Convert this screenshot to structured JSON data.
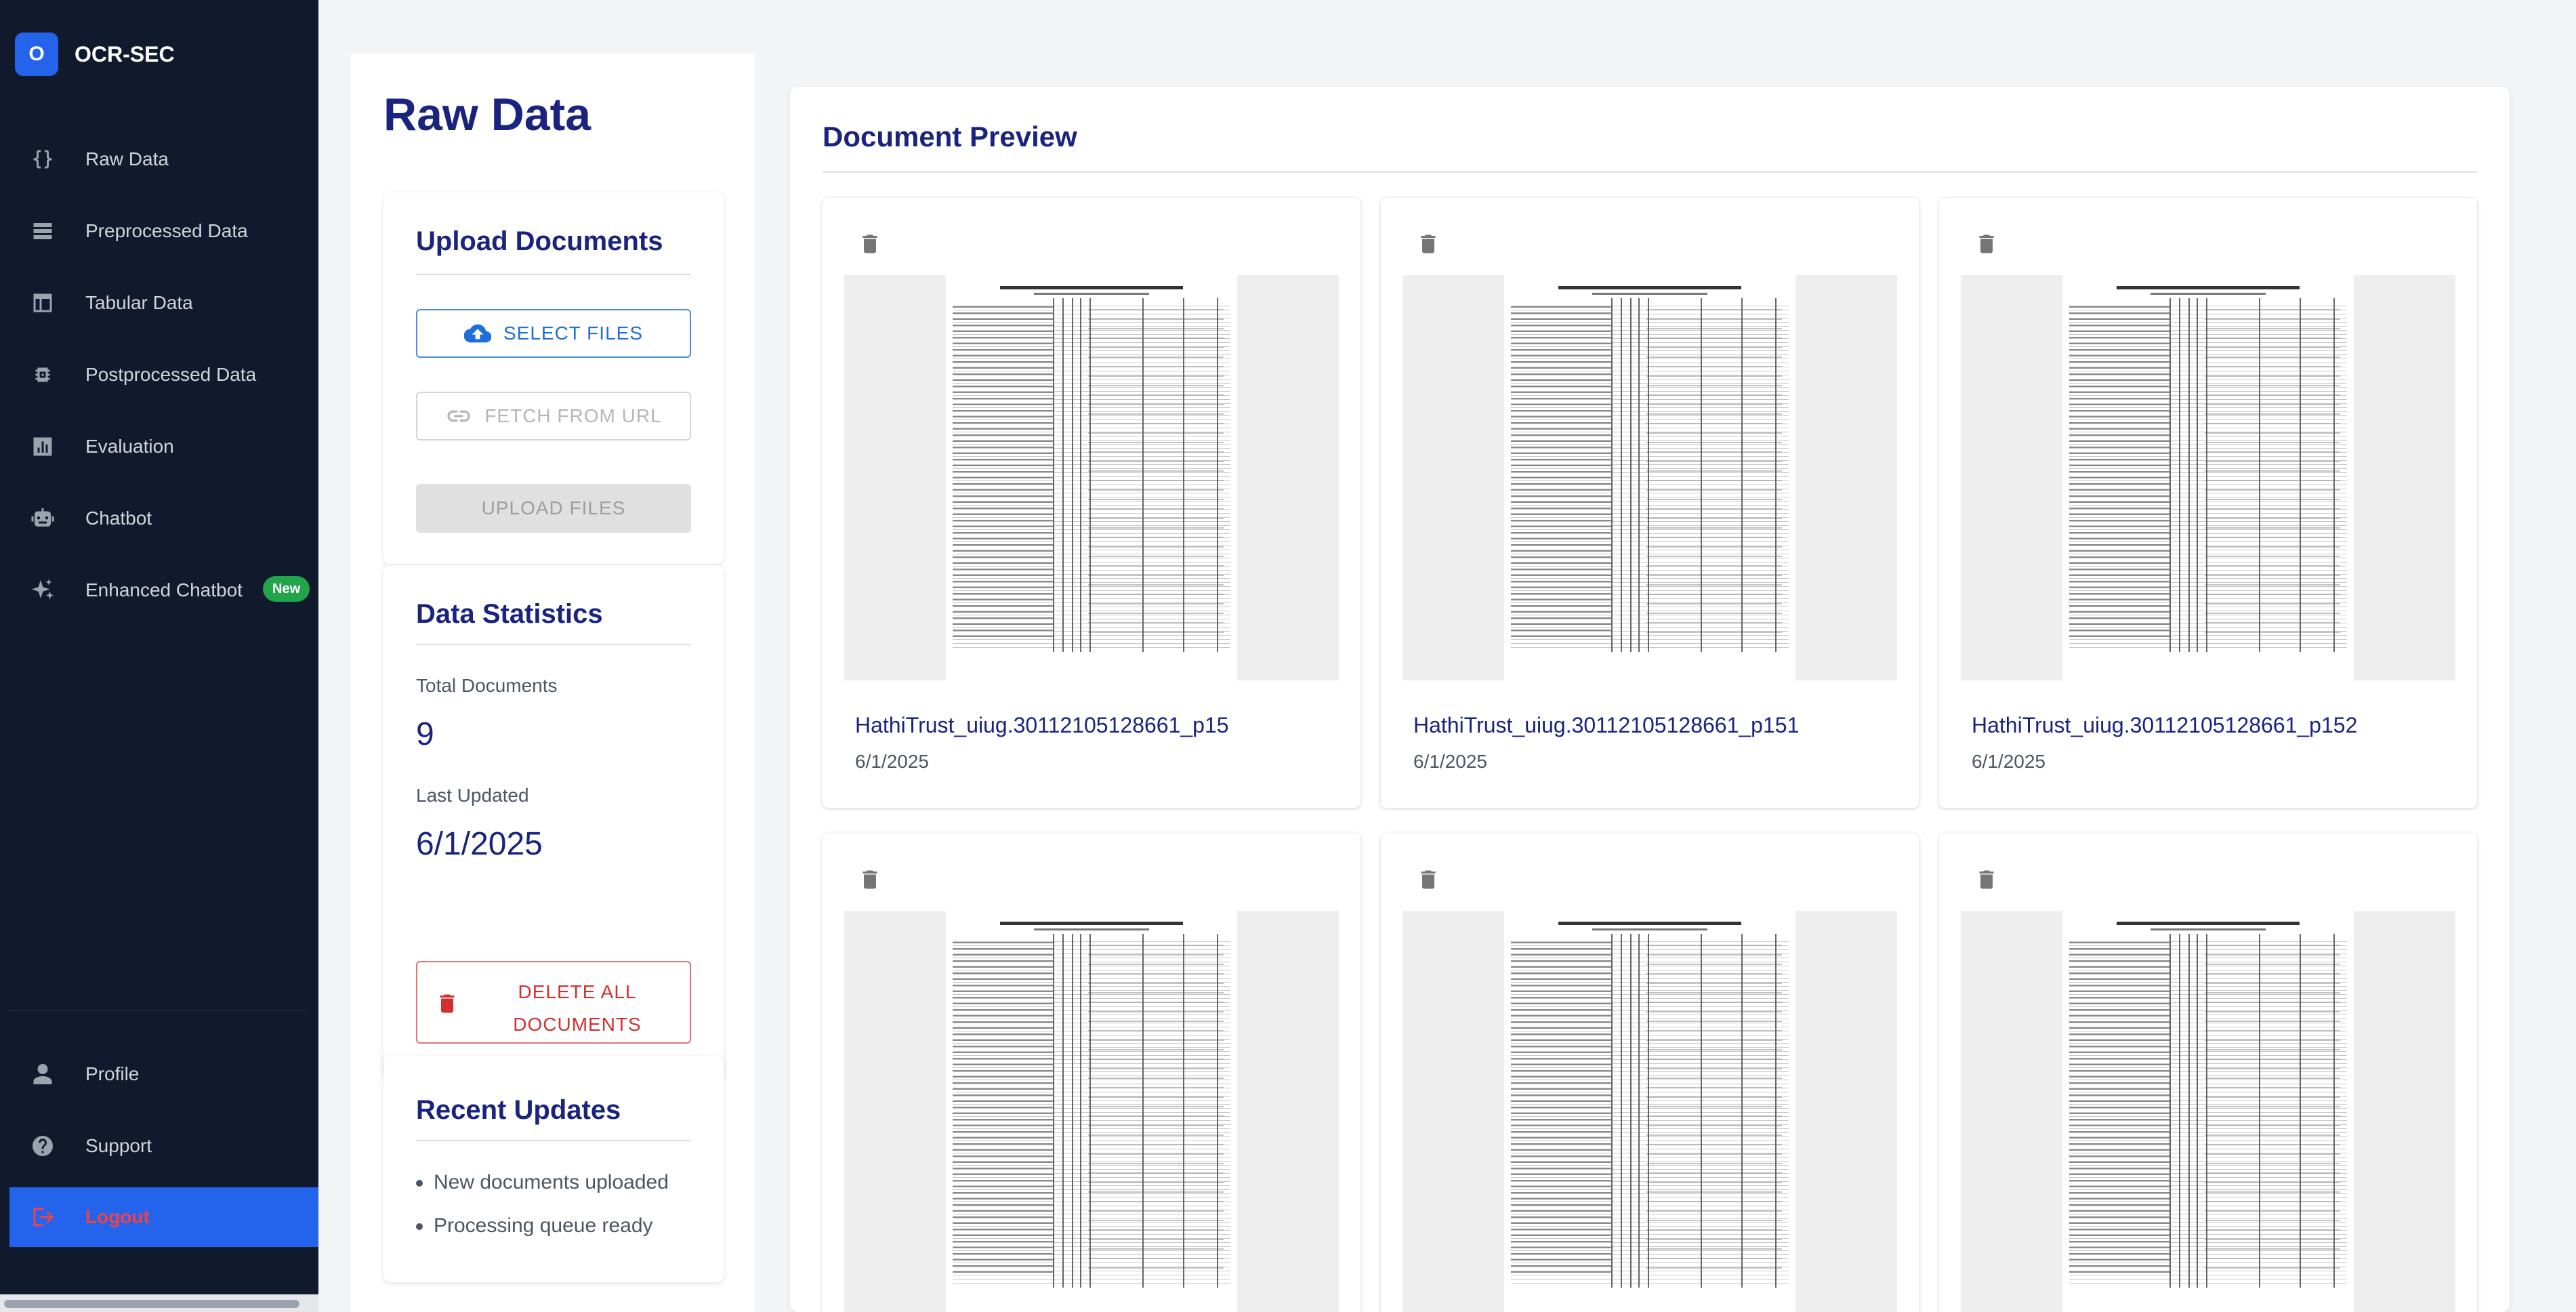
{
  "app": {
    "badge": "O",
    "name": "OCR-SEC"
  },
  "sidebar": {
    "items": [
      {
        "label": "Raw Data",
        "icon": "code-braces-icon"
      },
      {
        "label": "Preprocessed Data",
        "icon": "list-icon"
      },
      {
        "label": "Tabular Data",
        "icon": "table-icon"
      },
      {
        "label": "Postprocessed Data",
        "icon": "settings-chip-icon"
      },
      {
        "label": "Evaluation",
        "icon": "chart-icon"
      },
      {
        "label": "Chatbot",
        "icon": "robot-icon"
      },
      {
        "label": "Enhanced Chatbot",
        "icon": "sparkle-icon",
        "badge": "New"
      }
    ],
    "bottom": [
      {
        "label": "Profile",
        "icon": "person-icon"
      },
      {
        "label": "Support",
        "icon": "help-icon"
      },
      {
        "label": "Logout",
        "icon": "logout-icon"
      }
    ]
  },
  "page": {
    "title": "Raw Data"
  },
  "upload": {
    "title": "Upload Documents",
    "select_label": "SELECT FILES",
    "fetch_label": "FETCH FROM URL",
    "upload_label": "UPLOAD FILES"
  },
  "stats": {
    "title": "Data Statistics",
    "total_label": "Total Documents",
    "total_value": "9",
    "updated_label": "Last Updated",
    "updated_value": "6/1/2025",
    "delete_label": "DELETE ALL DOCUMENTS"
  },
  "updates": {
    "title": "Recent Updates",
    "items": [
      "New documents uploaded",
      "Processing queue ready"
    ]
  },
  "preview": {
    "title": "Document Preview",
    "documents": [
      {
        "name": "HathiTrust_uiug.30112105128661_p15",
        "date": "6/1/2025"
      },
      {
        "name": "HathiTrust_uiug.30112105128661_p151",
        "date": "6/1/2025"
      },
      {
        "name": "HathiTrust_uiug.30112105128661_p152",
        "date": "6/1/2025"
      },
      {
        "name": "",
        "date": ""
      },
      {
        "name": "",
        "date": ""
      },
      {
        "name": "",
        "date": ""
      }
    ]
  },
  "colors": {
    "sidebar_bg": "#111a2c",
    "accent": "#2563eb",
    "title": "#1a237e",
    "badge_new": "#22a54a",
    "danger": "#d32f2f"
  }
}
